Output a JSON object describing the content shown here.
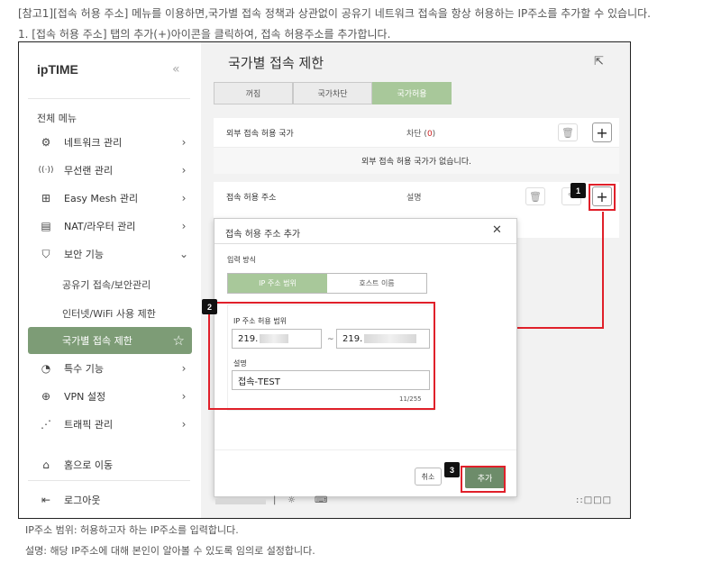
{
  "doc": {
    "intro_line1": "[참고1][접속 허용 주소] 메뉴를 이용하면,국가별 접속 정책과 상관없이 공유기 네트워크 접속을 항상 허용하는 IP주소를 추가할 수 있습니다.",
    "intro_line2": "1. [접속 허용 주소] 탭의 추가(+)아이콘을 클릭하여, 접속 허용주소를 추가합니다.",
    "footer_line1": "IP주소 범위: 허용하고자 하는 IP주소를 입력합니다.",
    "footer_line2": "설명: 해당 IP주소에 대해 본인이 알아볼 수 있도록 임의로 설정합니다."
  },
  "sidebar": {
    "logo_prefix": "ip",
    "logo_main": "TIME",
    "collapse_glyph": "«",
    "section_title": "전체 메뉴",
    "items": [
      {
        "label": "네트워크 관리",
        "icon": "network-icon",
        "glyph": "⚙"
      },
      {
        "label": "무선랜 관리",
        "icon": "wireless-icon",
        "glyph": "((·))"
      },
      {
        "label": "Easy Mesh 관리",
        "icon": "mesh-icon",
        "glyph": "⊞"
      },
      {
        "label": "NAT/라우터 관리",
        "icon": "router-icon",
        "glyph": "▤"
      },
      {
        "label": "보안 기능",
        "icon": "shield-icon",
        "glyph": "⛉"
      }
    ],
    "sub_items": [
      "공유기 접속/보안관리",
      "인터넷/WiFi 사용 제한"
    ],
    "active_item": "국가별 접속 제한",
    "after_items": [
      {
        "label": "특수 기능",
        "icon": "speed-icon",
        "glyph": "◔"
      },
      {
        "label": "VPN 설정",
        "icon": "globe-icon",
        "glyph": "⊕"
      },
      {
        "label": "트래픽 관리",
        "icon": "traffic-icon",
        "glyph": "⋰"
      }
    ],
    "home_label": "홈으로 이동",
    "logout_label": "로그아웃"
  },
  "main": {
    "page_title": "국가별 접속 제한",
    "tabs": [
      "꺼짐",
      "국가차단",
      "국가허용"
    ],
    "selected_tab": "국가허용",
    "panel1": {
      "label": "외부 접속 허용 국가",
      "blocked_label": "차단 (",
      "blocked_count": "0",
      "blocked_close": ")",
      "empty_text": "외부 접속 허용 국가가 없습니다."
    },
    "panel2": {
      "label": "접속 허용 주소",
      "desc_col": "설명"
    }
  },
  "modal": {
    "title": "접속 허용 주소 추가",
    "input_method_label": "입력 방식",
    "method_options": [
      "IP 주소 범위",
      "호스트 이름"
    ],
    "selected_method": "IP 주소 범위",
    "range_label": "IP 주소 허용 범위",
    "range_start_prefix": "219.",
    "range_end_prefix": "219.",
    "range_sep": "~",
    "desc_label": "설명",
    "desc_value": "접속-TEST",
    "desc_counter": "11/255",
    "cancel_label": "취소",
    "add_label": "추가"
  },
  "annotations": {
    "badges": [
      "1",
      "2",
      "3"
    ],
    "highlight_color": "#e0202a"
  },
  "colors": {
    "accent_green": "#7d9c76",
    "tab_selected": "#a8c89a",
    "add_button": "#6d8c6a"
  }
}
